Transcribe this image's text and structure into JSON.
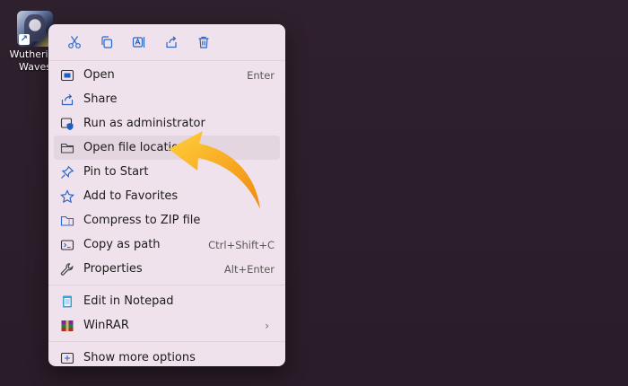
{
  "desktop": {
    "icon_label": "Wuthering Waves"
  },
  "quick_actions": [
    {
      "name": "cut-icon"
    },
    {
      "name": "copy-icon"
    },
    {
      "name": "rename-icon"
    },
    {
      "name": "share-icon"
    },
    {
      "name": "delete-icon"
    }
  ],
  "menu": {
    "items": [
      {
        "label": "Open",
        "shortcut": "Enter",
        "icon": "open-icon"
      },
      {
        "label": "Share",
        "shortcut": "",
        "icon": "share-icon"
      },
      {
        "label": "Run as administrator",
        "shortcut": "",
        "icon": "shield-icon"
      },
      {
        "label": "Open file location",
        "shortcut": "",
        "icon": "folder-icon"
      },
      {
        "label": "Pin to Start",
        "shortcut": "",
        "icon": "pin-icon"
      },
      {
        "label": "Add to Favorites",
        "shortcut": "",
        "icon": "star-icon"
      },
      {
        "label": "Compress to ZIP file",
        "shortcut": "",
        "icon": "zip-folder-icon"
      },
      {
        "label": "Copy as path",
        "shortcut": "Ctrl+Shift+C",
        "icon": "copy-path-icon"
      },
      {
        "label": "Properties",
        "shortcut": "Alt+Enter",
        "icon": "wrench-icon"
      },
      {
        "label": "Edit in Notepad",
        "shortcut": "",
        "icon": "notepad-icon"
      },
      {
        "label": "WinRAR",
        "shortcut": "",
        "icon": "winrar-icon"
      },
      {
        "label": "Show more options",
        "shortcut": "",
        "icon": "more-options-icon"
      }
    ]
  },
  "colors": {
    "desktop_bg": "#2e1f2c",
    "menu_bg": "#f0e2ec",
    "hover_bg": "#e4d6e0",
    "accent_blue": "#1a5fc4",
    "arrow_orange": "#f7a21b"
  }
}
